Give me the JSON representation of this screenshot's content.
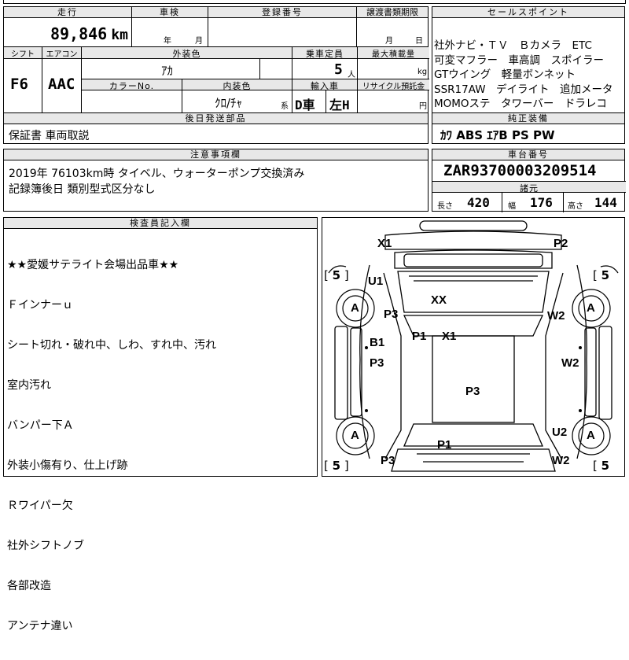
{
  "top_strip": {
    "cut_text": "---"
  },
  "mileage": {
    "header": "走行",
    "value": "89,846",
    "unit": "km"
  },
  "inspection": {
    "header": "車検",
    "year_unit": "年",
    "month_unit": "月"
  },
  "registration": {
    "header": "登録番号"
  },
  "transfer": {
    "header": "譲渡書類期限",
    "month_unit": "月",
    "day_unit": "日"
  },
  "shift": {
    "header": "シフト",
    "value": "F6"
  },
  "ac": {
    "header": "エアコン",
    "value": "AAC"
  },
  "exterior_color": {
    "header": "外装色",
    "value": "ｱｶ"
  },
  "capacity": {
    "header": "乗車定員",
    "value": "5",
    "unit": "人"
  },
  "max_load": {
    "header": "最大積載量",
    "unit": "kg"
  },
  "color_no": {
    "header": "カラーNo."
  },
  "interior_color": {
    "header": "内装色",
    "value": "ｸﾛ/ﾁｬ",
    "suffix": "系"
  },
  "import": {
    "header": "輸入車",
    "value1": "D車",
    "value2": "左H"
  },
  "recycle": {
    "header": "リサイクル預託金",
    "unit": "円"
  },
  "later_parts": {
    "header": "後日発送部品",
    "value": "保証書 車両取説"
  },
  "caution": {
    "header": "注意事項欄",
    "lines": [
      "2019年 76103km時 タイベル、ウォーターポンプ交換済み",
      "記録簿後日 類別型式区分なし"
    ]
  },
  "selling_points": {
    "header": "セールスポイント",
    "lines": [
      "社外ナビ・ＴＶ　Ｂカメラ　ETC",
      "可変マフラー　車高調　スポイラー",
      "GTウイング　軽量ボンネット",
      "SSR17AW　デイライト　追加メータ",
      "MOMOステ　タワーバー　ドラレコ"
    ]
  },
  "standard_equipment": {
    "header": "純正装備",
    "value": "ｶﾜ ABS ｴｱB PS PW"
  },
  "chassis": {
    "header": "車台番号",
    "value": "ZAR93700003209514"
  },
  "dimensions": {
    "header": "諸元",
    "length_label": "長さ",
    "length": "420",
    "width_label": "幅",
    "width": "176",
    "height_label": "高さ",
    "height": "144"
  },
  "inspector": {
    "header": "検査員記入欄",
    "lines": [
      "★★愛媛サテライト会場出品車★★",
      "Ｆインナーｕ",
      "シート切れ・破れ中、しわ、すれ中、汚れ",
      "室内汚れ",
      "バンパー下Ａ",
      "外装小傷有り、仕上げ跡",
      "Ｒワイパー欠",
      "社外シフトノブ",
      "各部改造",
      "アンテナ違い"
    ]
  },
  "damage_map": {
    "tire_fl": "5",
    "tire_fr": "5",
    "tire_rl": "5",
    "tire_rr": "5",
    "marks": {
      "x1_top": "X1",
      "p2_top": "P2",
      "u1": "U1",
      "a_fl": "A",
      "p3_left": "P3",
      "xx": "XX",
      "w2_right": "W2",
      "a_fr": "A",
      "b1": "B1",
      "p1_mid": "P1",
      "x1_mid": "X1",
      "p3_left2": "P3",
      "w2_right2": "W2",
      "p3_center": "P3",
      "u2": "U2",
      "a_rl": "A",
      "a_rr": "A",
      "p1_bottom": "P1",
      "p3_bottom": "P3",
      "w2_bottom": "W2"
    }
  }
}
